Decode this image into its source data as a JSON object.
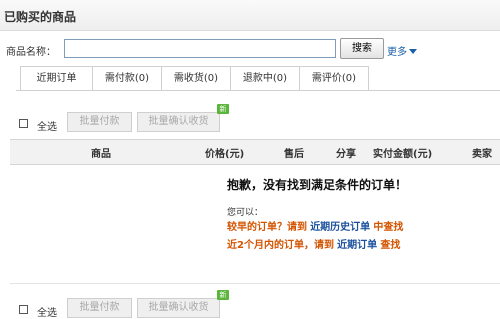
{
  "page": {
    "title": "已购买的商品"
  },
  "search": {
    "label": "商品名称：",
    "value": "",
    "button_label": "搜索",
    "more_label": "更多"
  },
  "tabs": [
    {
      "label": "近期订单"
    },
    {
      "label": "需付款(0)"
    },
    {
      "label": "需收货(0)"
    },
    {
      "label": "退款中(0)"
    },
    {
      "label": "需评价(0)"
    }
  ],
  "actions": {
    "select_all_label": "全选",
    "batch_pay_label": "批量付款",
    "batch_confirm_label": "批量确认收货",
    "new_badge_label": "新"
  },
  "table": {
    "columns": [
      "商品",
      "价格(元)",
      "售后",
      "分享",
      "实付金额(元)",
      "卖家"
    ]
  },
  "empty_state": {
    "title": "抱歉，没有找到满足条件的订单！",
    "can_label": "您可以：",
    "line1_text": "较早的订单？请到",
    "line1_link": "近期历史订单",
    "line1_action": "中查找",
    "line2_text": "近2个月内的订单，请到",
    "line2_link": "近期订单",
    "line2_action": "查找"
  },
  "colors": {
    "link_blue": "#1a4f9c",
    "accent_orange": "#d35400",
    "new_badge_green": "#5bb53a"
  },
  "icons": {
    "more": "triangle-down-icon",
    "new": "new-badge-icon"
  }
}
